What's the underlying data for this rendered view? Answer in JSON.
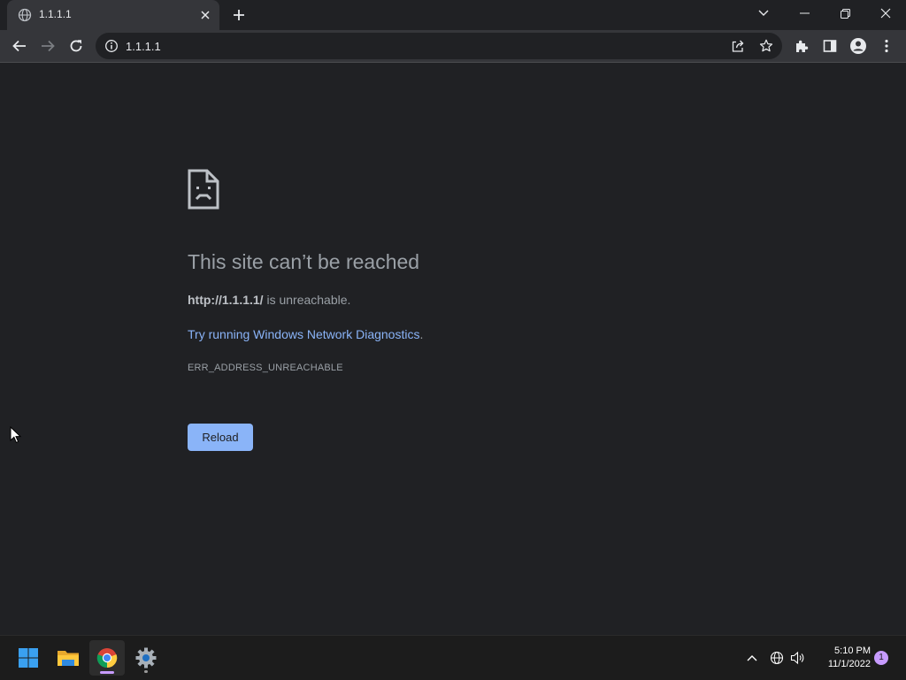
{
  "browser": {
    "tab_title": "1.1.1.1",
    "url": "1.1.1.1"
  },
  "error": {
    "title": "This site can’t be reached",
    "host": "http://1.1.1.1/",
    "unreachable_text": " is unreachable.",
    "diagnostics_link": "Try running Windows Network Diagnostics",
    "diagnostics_suffix": ".",
    "code": "ERR_ADDRESS_UNREACHABLE",
    "reload_label": "Reload"
  },
  "taskbar": {
    "time": "5:10 PM",
    "date": "11/1/2022",
    "notification_count": "1",
    "apps": [
      "start-icon",
      "file-explorer-icon",
      "chrome-icon",
      "settings-icon"
    ]
  },
  "colors": {
    "background": "#202124",
    "toolbar": "#35363a",
    "link": "#8ab4f8",
    "button": "#8ab4f8",
    "text_muted": "#9aa0a6"
  }
}
